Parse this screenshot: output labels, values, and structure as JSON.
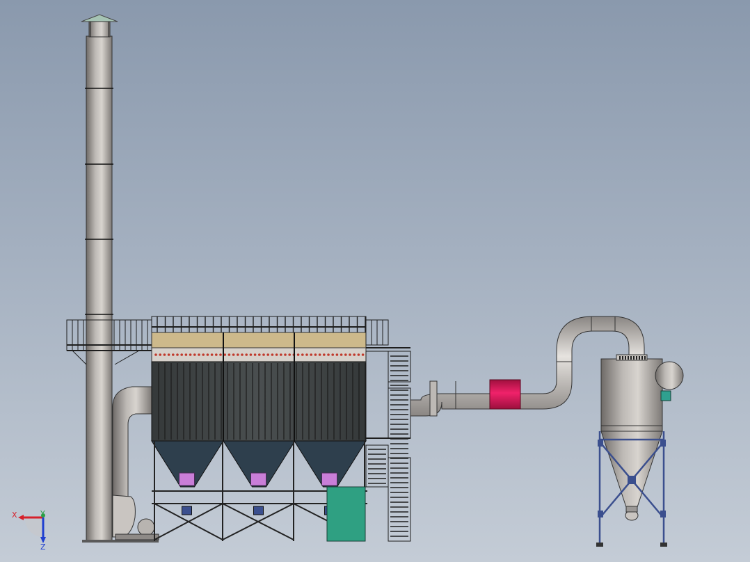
{
  "viewport": {
    "background_top": "#8a99ad",
    "background_bottom": "#c4ccd6"
  },
  "triad": {
    "x_label": "X",
    "y_label": "Y",
    "z_label": "Z",
    "x_color": "#d6202a",
    "y_color": "#2aa046",
    "z_color": "#1f3fd0"
  },
  "colors": {
    "steel": "#9b9896",
    "pipe_light": "#e2dfdc",
    "frame": "#1e1e1e",
    "filter_body": "#3f4546",
    "hopper": "#2e3f4d",
    "purple_valve": "#c97ed8",
    "green_box": "#2fa082",
    "pink_section": "#e0195d",
    "cyclone_frame": "#3b4f8e"
  },
  "components": [
    {
      "icon": "chimney-stack-icon"
    },
    {
      "icon": "bag-filter-icon"
    },
    {
      "icon": "duct-pipe-icon"
    },
    {
      "icon": "cyclone-separator-icon"
    },
    {
      "icon": "stair-tower-icon"
    },
    {
      "icon": "fan-blower-icon"
    }
  ]
}
